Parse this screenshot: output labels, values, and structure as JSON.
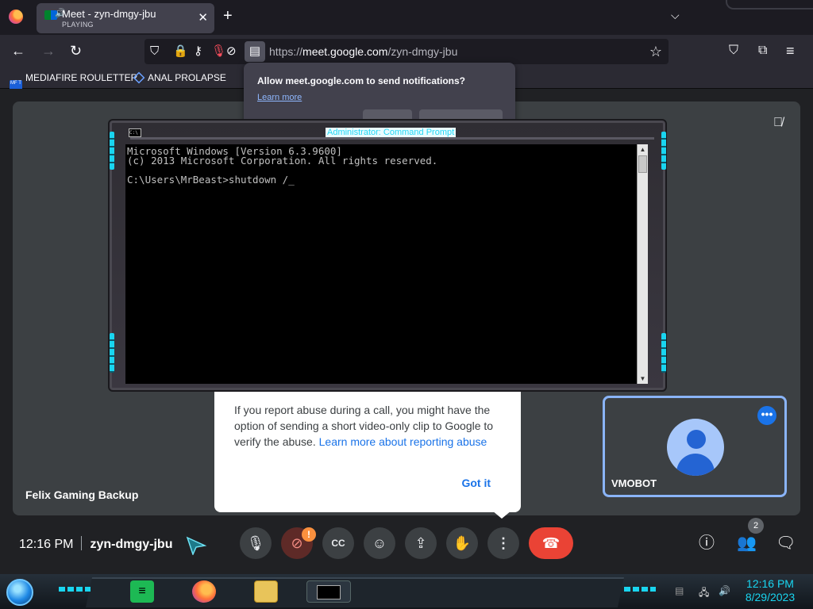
{
  "browser": {
    "tab": {
      "title": "Meet - zyn-dmgy-jbu",
      "subtitle": "PLAYING",
      "close": "✕"
    },
    "new_tab": "+",
    "tab_list": "⌵",
    "url_host_prefix": "https://",
    "url_host": "meet.google.com",
    "url_path": "/zyn-dmgy-jbu",
    "bookmarks": [
      {
        "label": "MEDIAFIRE ROULETTER",
        "icon": "MF T"
      },
      {
        "label": "ANAL PROLAPSE"
      }
    ]
  },
  "notification": {
    "question": "Allow meet.google.com to send notifications?",
    "learn_more": "Learn more"
  },
  "cmd": {
    "title": "Administrator: Command Prompt",
    "icon_text": "C:\\",
    "lines": "Microsoft Windows [Version 6.3.9600]\n(c) 2013 Microsoft Corporation. All rights reserved.\n\nC:\\Users\\MrBeast>shutdown /_"
  },
  "meet": {
    "stage_name": "Felix Gaming Backup",
    "abuse_text_1": "If you report abuse during a call, you might have the option of sending a short video-only clip to Google to verify the abuse. ",
    "abuse_link": "Learn more about reporting abuse",
    "got_it": "Got it",
    "tile_name": "VMOBOT",
    "time": "12:16 PM",
    "meeting_code": "zyn-dmgy-jbu",
    "people_count": "2",
    "camera_warning": "!"
  },
  "taskbar": {
    "clock_time": "12:16 PM",
    "clock_date": "8/29/2023"
  },
  "colors": {
    "accent": "#1a73e8",
    "end_call": "#ea4335",
    "cmd_glow": "#19d5f0"
  }
}
